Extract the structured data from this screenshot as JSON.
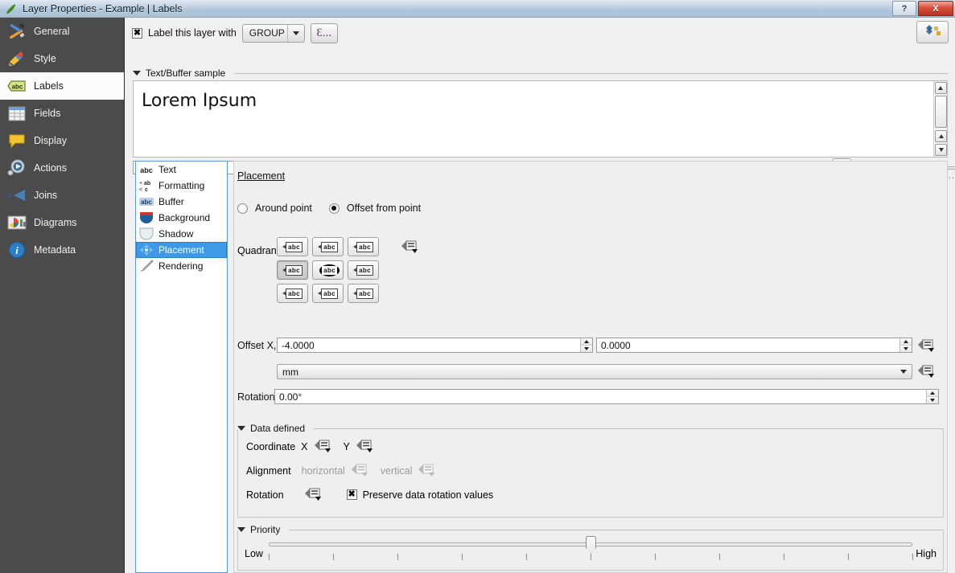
{
  "window": {
    "title": "Layer Properties - Example | Labels",
    "app_icon": "qgis-icon",
    "help_button": "?",
    "close_button": "X"
  },
  "sidebar": {
    "items": [
      {
        "label": "General",
        "icon": "tools-icon",
        "selected": false
      },
      {
        "label": "Style",
        "icon": "brush-icon",
        "selected": false
      },
      {
        "label": "Labels",
        "icon": "abc-label-icon",
        "selected": true
      },
      {
        "label": "Fields",
        "icon": "table-icon",
        "selected": false
      },
      {
        "label": "Display",
        "icon": "speech-bubble-icon",
        "selected": false
      },
      {
        "label": "Actions",
        "icon": "gear-play-icon",
        "selected": false
      },
      {
        "label": "Joins",
        "icon": "join-arrow-icon",
        "selected": false
      },
      {
        "label": "Diagrams",
        "icon": "chart-icon",
        "selected": false
      },
      {
        "label": "Metadata",
        "icon": "info-icon",
        "selected": false
      }
    ]
  },
  "toolbar": {
    "label_layer_checkbox": {
      "label": "Label this layer with",
      "checked": true,
      "mark": "✖"
    },
    "field_combo": {
      "value": "GROUP",
      "arrow": "chevron-down-icon"
    },
    "expression_button": {
      "label": "Ɛ...",
      "name": "expression-editor-button"
    },
    "label_settings_button": {
      "name": "labeling-settings-icon"
    }
  },
  "sample": {
    "group_title": "Text/Buffer sample",
    "preview_text": "Lorem Ipsum",
    "input_value": "Lorem Ipsum",
    "revert_button": "revert-icon",
    "zoom_value": ""
  },
  "inner_list": {
    "items": [
      {
        "label": "Text",
        "icon": "abc-text-icon",
        "selected": false
      },
      {
        "label": "Formatting",
        "icon": "formatting-icon",
        "selected": false
      },
      {
        "label": "Buffer",
        "icon": "abc-buffer-icon",
        "selected": false
      },
      {
        "label": "Background",
        "icon": "background-shield-icon",
        "selected": false
      },
      {
        "label": "Shadow",
        "icon": "shadow-shield-icon",
        "selected": false
      },
      {
        "label": "Placement",
        "icon": "placement-arrows-icon",
        "selected": true
      },
      {
        "label": "Rendering",
        "icon": "brush-render-icon",
        "selected": false
      }
    ]
  },
  "placement": {
    "title": "Placement",
    "mode_options": [
      {
        "label": "Around point",
        "selected": false
      },
      {
        "label": "Offset from point",
        "selected": true
      }
    ],
    "quadrant": {
      "label": "Quadrant",
      "cells": [
        {
          "name": "quadrant-top-left",
          "active": false,
          "center": false
        },
        {
          "name": "quadrant-top-center",
          "active": false,
          "center": false
        },
        {
          "name": "quadrant-top-right",
          "active": false,
          "center": false
        },
        {
          "name": "quadrant-middle-left",
          "active": true,
          "center": false
        },
        {
          "name": "quadrant-center",
          "active": false,
          "center": true
        },
        {
          "name": "quadrant-middle-right",
          "active": false,
          "center": false
        },
        {
          "name": "quadrant-bottom-left",
          "active": false,
          "center": false
        },
        {
          "name": "quadrant-bottom-center",
          "active": false,
          "center": false
        },
        {
          "name": "quadrant-bottom-right",
          "active": false,
          "center": false
        }
      ],
      "cell_text": "abc"
    },
    "offset": {
      "label": "Offset X,Y",
      "x_value": "-4.0000",
      "y_value": "0.0000",
      "unit_value": "mm"
    },
    "rotation": {
      "label": "Rotation",
      "value": "0.00°"
    }
  },
  "data_defined": {
    "title": "Data defined",
    "coordinate": {
      "label": "Coordinate",
      "x_label": "X",
      "y_label": "Y"
    },
    "alignment": {
      "label": "Alignment",
      "horizontal_label": "horizontal",
      "vertical_label": "vertical"
    },
    "rotation": {
      "label": "Rotation"
    },
    "preserve_checkbox": {
      "label": "Preserve data rotation values",
      "checked": true,
      "mark": "✖"
    }
  },
  "priority": {
    "title": "Priority",
    "low_label": "Low",
    "high_label": "High",
    "value_ratio": 0.5,
    "tick_count": 11
  },
  "colors": {
    "sidebar_bg": "#4b4b4b",
    "selection_blue": "#3d9ae8",
    "panel_bg": "#efefef",
    "window_bg": "#f0f0f0"
  }
}
